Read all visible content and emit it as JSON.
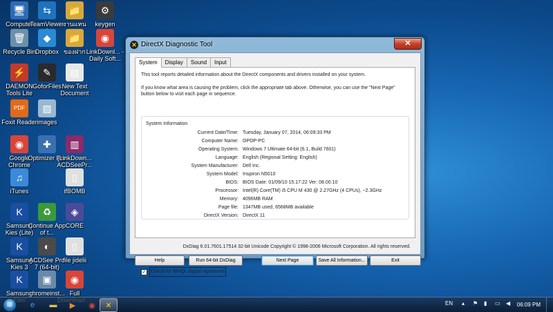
{
  "desktop": {
    "icons": [
      {
        "label": "Computer",
        "icon": "computer-icon",
        "glyph": "🖥",
        "color": "#2d6bb5"
      },
      {
        "label": "TeamViewer 8",
        "icon": "teamviewer-icon",
        "glyph": "⇆",
        "color": "#1e73be"
      },
      {
        "label": "งานแทน",
        "icon": "folder-icon",
        "glyph": "📁",
        "color": "#d9a83a"
      },
      {
        "label": "keygen",
        "icon": "keygen-icon",
        "glyph": "⚙",
        "color": "#3a3a3a"
      },
      {
        "label": "Recycle Bin",
        "icon": "recycle-bin-icon",
        "glyph": "🗑",
        "color": "#6d8fa8"
      },
      {
        "label": "Dropbox",
        "icon": "dropbox-icon",
        "glyph": "◆",
        "color": "#2a8ad4"
      },
      {
        "label": "ของฝาก",
        "icon": "folder-icon",
        "glyph": "📁",
        "color": "#d9a83a"
      },
      {
        "label": "LinkDownl... - Daily Soft...",
        "icon": "chrome-shortcut-icon",
        "glyph": "◉",
        "color": "#d8453a"
      },
      {
        "label": "DAEMON Tools Lite",
        "icon": "daemon-tools-icon",
        "glyph": "⚡",
        "color": "#c23a2a"
      },
      {
        "label": "GoforFiles",
        "icon": "goforfiles-icon",
        "glyph": "✎",
        "color": "#2a2a2a"
      },
      {
        "label": "New Text Document",
        "icon": "text-document-icon",
        "glyph": "▤",
        "color": "#e8e8e8"
      },
      {
        "label": "Foxit Reader",
        "icon": "foxit-reader-icon",
        "glyph": "PDF",
        "color": "#e06a1a"
      },
      {
        "label": "images",
        "icon": "image-file-icon",
        "glyph": "▧",
        "color": "#9ab8d0"
      },
      {
        "label": "Google Chrome",
        "icon": "chrome-icon",
        "glyph": "◉",
        "color": "#d8453a"
      },
      {
        "label": "Optimizer Pro",
        "icon": "optimizer-pro-icon",
        "glyph": "✚",
        "color": "#3a6fb0"
      },
      {
        "label": "[LinkDown... ACDSeePr...",
        "icon": "winrar-icon",
        "glyph": "▥",
        "color": "#8a2a6a"
      },
      {
        "label": "iTunes",
        "icon": "itunes-icon",
        "glyph": "♫",
        "color": "#3a8ad8"
      },
      {
        "label": "ifBOMB",
        "icon": "file-icon",
        "glyph": "▯",
        "color": "#e0e0e0"
      },
      {
        "label": "Samsung Kies (Lite)",
        "icon": "samsung-kies-lite-icon",
        "glyph": "K",
        "color": "#1a4ea0"
      },
      {
        "label": "Continue App of t...",
        "icon": "continue-app-icon",
        "glyph": "♻",
        "color": "#3a9a3a"
      },
      {
        "label": "CORE",
        "icon": "core-icon",
        "glyph": "◈",
        "color": "#4a4a9a"
      },
      {
        "label": "Samsung Kies 3",
        "icon": "samsung-kies-3-icon",
        "glyph": "K",
        "color": "#1a4ea0"
      },
      {
        "label": "ACDSee Pro 7 (64-bit)",
        "icon": "acdsee-icon",
        "glyph": "◐",
        "color": "#4a4a4a"
      },
      {
        "label": "file jidelii",
        "icon": "file-icon",
        "glyph": "▯",
        "color": "#e0e0e0"
      },
      {
        "label": "Samsung Kies",
        "icon": "samsung-kies-icon",
        "glyph": "K",
        "color": "#1a4ea0"
      },
      {
        "label": "chromeinst...",
        "icon": "chrome-installer-icon",
        "glyph": "▣",
        "color": "#6a8aa8"
      },
      {
        "label": "Full Download ...",
        "icon": "chrome-shortcut-icon",
        "glyph": "◉",
        "color": "#d8453a"
      }
    ]
  },
  "window": {
    "title": "DirectX Diagnostic Tool",
    "close_label": "✕",
    "tabs": [
      "System",
      "Display",
      "Sound",
      "Input"
    ],
    "intro_1": "This tool reports detailed information about the DirectX components and drivers installed on your system.",
    "intro_2": "If you know what area is causing the problem, click the appropriate tab above.  Otherwise, you can use the \"Next Page\" button below to visit each page in sequence.",
    "group_title": "System Information",
    "rows": [
      {
        "label": "Current Date/Time:",
        "value": "Tuesday, January 07, 2014, 06:09:33 PM"
      },
      {
        "label": "Computer Name:",
        "value": "OPOP-PC"
      },
      {
        "label": "Operating System:",
        "value": "Windows 7 Ultimate 64-bit (6.1, Build 7601)"
      },
      {
        "label": "Language:",
        "value": "English (Regional Setting: English)"
      },
      {
        "label": "System Manufacturer:",
        "value": "Dell Inc."
      },
      {
        "label": "System Model:",
        "value": "Inspiron N5010"
      },
      {
        "label": "BIOS:",
        "value": "BIOS Date: 01/09/10 15:17:22 Ver: 08.00.10"
      },
      {
        "label": "Processor:",
        "value": "Intel(R) Core(TM) i5 CPU       M 430  @ 2.27GHz (4 CPUs), ~2.3GHz"
      },
      {
        "label": "Memory:",
        "value": "4096MB RAM"
      },
      {
        "label": "Page file:",
        "value": "1347MB used, 6568MB available"
      },
      {
        "label": "DirectX Version:",
        "value": "DirectX 11"
      }
    ],
    "whql_checked": "✓",
    "whql_label": "Check for WHQL digital signatures",
    "copyright": "DxDiag 6.01.7601.17514 32-bit Unicode  Copyright © 1998-2006 Microsoft Corporation.  All rights reserved.",
    "buttons": {
      "help": "Help",
      "run64": "Run 64-bit DxDiag",
      "next": "Next Page",
      "save": "Save All Information...",
      "exit": "Exit"
    }
  },
  "taskbar": {
    "start_glyph": "⊞",
    "pinned": [
      {
        "name": "taskbar-ie-icon",
        "glyph": "e",
        "color": "#3aa0e8"
      },
      {
        "name": "taskbar-explorer-icon",
        "glyph": "▬",
        "color": "#e8c04a"
      },
      {
        "name": "taskbar-media-player-icon",
        "glyph": "▶",
        "color": "#e88a2a"
      },
      {
        "name": "taskbar-chrome-icon",
        "glyph": "◉",
        "color": "#d8453a"
      },
      {
        "name": "taskbar-dxdiag-icon",
        "glyph": "✕",
        "color": "#ffd400"
      }
    ],
    "language": "EN",
    "time": "06:09 PM"
  }
}
